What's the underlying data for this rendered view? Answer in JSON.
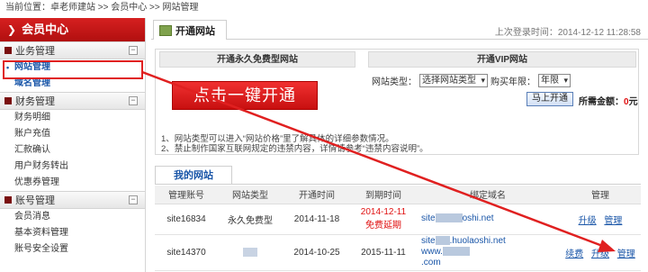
{
  "breadcrumb": "当前位置：卓老师建站 >> 会员中心 >> 网站管理",
  "sidebar": {
    "title": "会员中心",
    "groups": [
      {
        "label": "业务管理",
        "items": [
          "网站管理",
          "域名管理"
        ]
      },
      {
        "label": "财务管理",
        "items": [
          "财务明细",
          "账户充值",
          "汇款确认",
          "用户财务转出",
          "优惠券管理"
        ]
      },
      {
        "label": "账号管理",
        "items": [
          "会员消息",
          "基本资料管理",
          "账号安全设置"
        ]
      }
    ]
  },
  "main": {
    "tab_label": "开通网站",
    "last_login": "上次登录时间：2014-12-12 11:28:58",
    "free_header": "开通永久免费型网站",
    "vip_header": "开通VIP网站",
    "big_button": "点击一键开通",
    "site_type_label": "网站类型：",
    "site_type_value": "选择网站类型",
    "years_label": "购买年限：",
    "years_value": "年限",
    "buy_button": "马上开通",
    "total_label": "所需金额：",
    "total_value": "0",
    "total_unit": "元",
    "note1": "1、网站类型可以进入“网站价格”里了解具体的详细参数情况。",
    "note2": "2、禁止制作国家互联网规定的违禁内容，详情请参考“违禁内容说明”。"
  },
  "my_sites": {
    "tab_label": "我的网站",
    "headers": [
      "管理账号",
      "网站类型",
      "开通时间",
      "到期时间",
      "绑定域名",
      "管理"
    ],
    "rows": [
      {
        "account": "site16834",
        "type": "永久免费型",
        "open": "2014-11-18",
        "due": "2014-12-11",
        "due_note": "免费延期",
        "domain1": "site",
        "domain1b": "oshi.net",
        "domain2": "",
        "actions": [
          "升级",
          "管理"
        ]
      },
      {
        "account": "site14370",
        "type": "",
        "open": "2014-10-25",
        "due": "2015-11-11",
        "due_note": "",
        "domain1": "site",
        "domain1b": ".huolaoshi.net",
        "domain2": "www.",
        "domain3": ".com",
        "actions": [
          "续费",
          "升级",
          "管理"
        ]
      }
    ]
  },
  "colors": {
    "accent_red": "#d62020",
    "link_blue": "#1a56a8"
  }
}
